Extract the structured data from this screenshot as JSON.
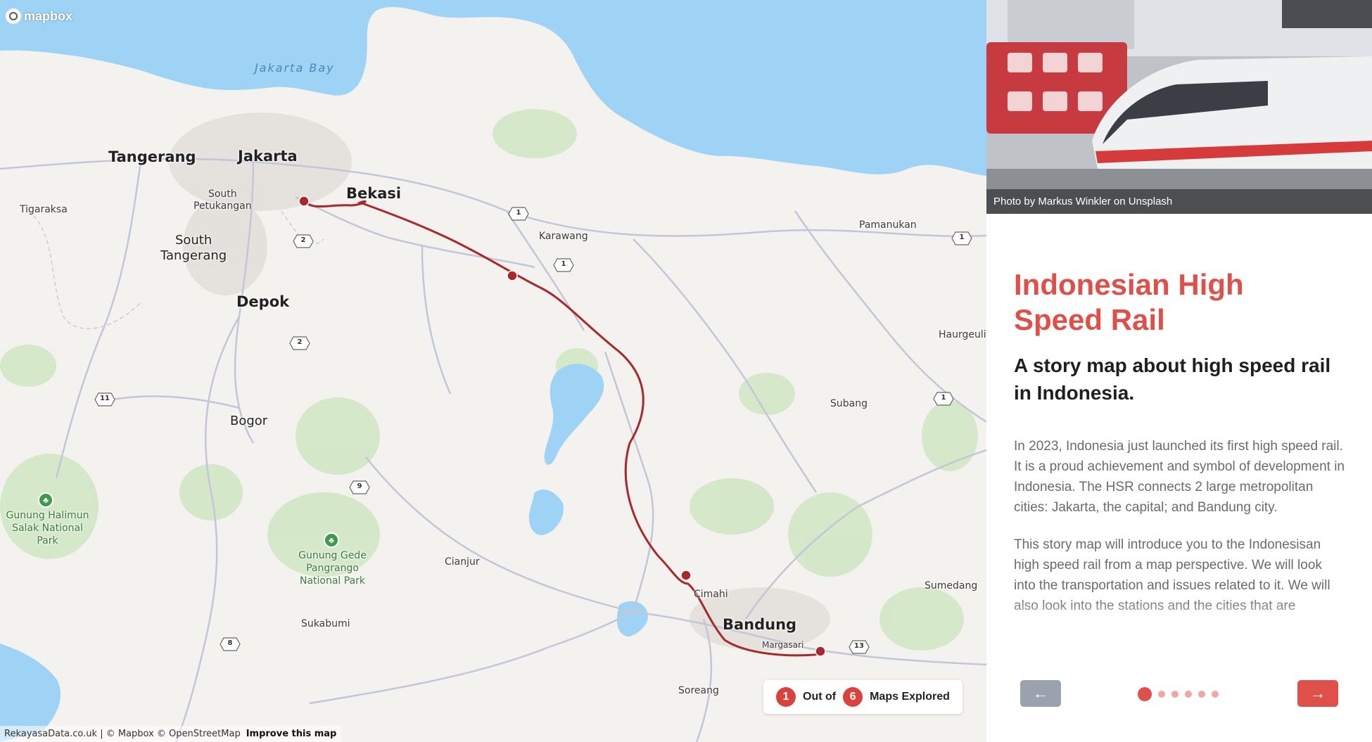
{
  "map": {
    "logo_text": "mapbox",
    "water_labels": {
      "bay": "Jakarta Bay"
    },
    "cities": {
      "tangerang": "Tangerang",
      "jakarta": "Jakarta",
      "bekasi": "Bekasi",
      "depok": "Depok",
      "bogor": "Bogor",
      "bandung": "Bandung",
      "south_tangerang": "South\nTangerang"
    },
    "towns": {
      "tigaraksa": "Tigaraksa",
      "south_petukangan": "South\nPetukangan",
      "karawang": "Karawang",
      "pamanukan": "Pamanukan",
      "haurgeulis": "Haurgeulis",
      "subang": "Subang",
      "cianjur": "Cianjur",
      "sukabumi": "Sukabumi",
      "cimahi": "Cimahi",
      "margasari": "Margasari",
      "soreang": "Soreang",
      "sumedang": "Sumedang"
    },
    "parks": {
      "halimun": "Gunung Halimun\nSalak National Park",
      "pangrango": "Gunung Gede Pangrango\nNational Park"
    },
    "road_shields": [
      "1",
      "1",
      "1",
      "1",
      "2",
      "2",
      "11",
      "9",
      "8",
      "13"
    ],
    "attribution": {
      "text": "RekayasaData.co.uk | © Mapbox © OpenStreetMap",
      "link": "Improve this map"
    },
    "counter": {
      "current": "1",
      "out_of_label": "Out of",
      "total": "6",
      "suffix": "Maps Explored"
    },
    "colors": {
      "route": "#a8282b",
      "station": "#a8282b",
      "water": "#9fd3f5",
      "land": "#f4f2ee"
    }
  },
  "panel": {
    "photo_caption": "Photo by Markus Winkler on Unsplash",
    "title": "Indonesian High Speed Rail",
    "subtitle": "A story map about high speed rail in Indonesia.",
    "paragraphs": [
      "In 2023, Indonesia just launched its first high speed rail. It is a proud achievement and symbol of development in Indonesia. The HSR connects 2 large metropolitan cities: Jakarta, the capital; and Bandung city.",
      "This story map will introduce you to the Indonesisan high speed rail from a map perspective. We will look into the transportation and issues related to it. We will also look into the stations and the cities that are"
    ],
    "prev_label": "←",
    "next_label": "→",
    "progress": {
      "current": 1,
      "total": 6
    },
    "accent_color": "#e0504b"
  }
}
